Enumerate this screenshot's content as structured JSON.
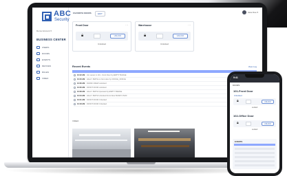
{
  "app": {
    "brand_line1": "ABC",
    "brand_line2": "Security",
    "account_label": "Demo Account ▾",
    "section_title": "BUSINESS CENTER"
  },
  "sidebar": {
    "items": [
      {
        "label": "USERS"
      },
      {
        "label": "DOORS"
      },
      {
        "label": "EVENTS"
      },
      {
        "label": "DEVICES"
      },
      {
        "label": "RULES"
      },
      {
        "label": "VIDEO"
      }
    ]
  },
  "header": {
    "tab_label": "FAVORITE DOORS",
    "edit_label": "EDIT",
    "user_name": "Jane Doe ▾"
  },
  "doors": [
    {
      "name": "Front Door",
      "unlock_label": "UNLOCK",
      "status": "Unlocked"
    },
    {
      "name": "Warehouse",
      "unlock_label": "UNLOCK",
      "status": "Unlocked"
    }
  ],
  "events": {
    "title": "Recent Events",
    "link": "View Log",
    "rows": [
      {
        "time": "10:42 AM",
        "text": "Jim Lamar in 101 - Front Door by EMPTY BADGE"
      },
      {
        "time": "10:40 AM",
        "text": "HALLY SMITH on front door by OFFICE_OFFICE"
      },
      {
        "time": "10:36 AM",
        "text": "FRANK CREW unlocked"
      },
      {
        "time": "10:30 AM",
        "text": "FRONT DOOR unlocked"
      },
      {
        "time": "10:28 AM",
        "text": "HALLY SMITH Operated by EMPTY BADGE"
      },
      {
        "time": "10:24 AM",
        "text": "HALLY SMITH Unlocked Front Door BUNNY PUFF"
      },
      {
        "time": "10:21 AM",
        "text": "FRONT DOOR Unlocked"
      },
      {
        "time": "10:18 AM",
        "text": "FRONT DOOR Unlocked"
      }
    ]
  },
  "video": {
    "label": "VIDEO"
  },
  "phone": {
    "time": "9:41",
    "header": "DOORS",
    "doors": [
      {
        "name": "101-Front Door",
        "sub": "Unlocked",
        "unlock_label": "UNLOCK",
        "status": "Locked"
      },
      {
        "name": "102-Office Door",
        "sub": "",
        "unlock_label": "UNLOCK",
        "status": "Locked"
      }
    ],
    "events_title": "EVENTS"
  }
}
